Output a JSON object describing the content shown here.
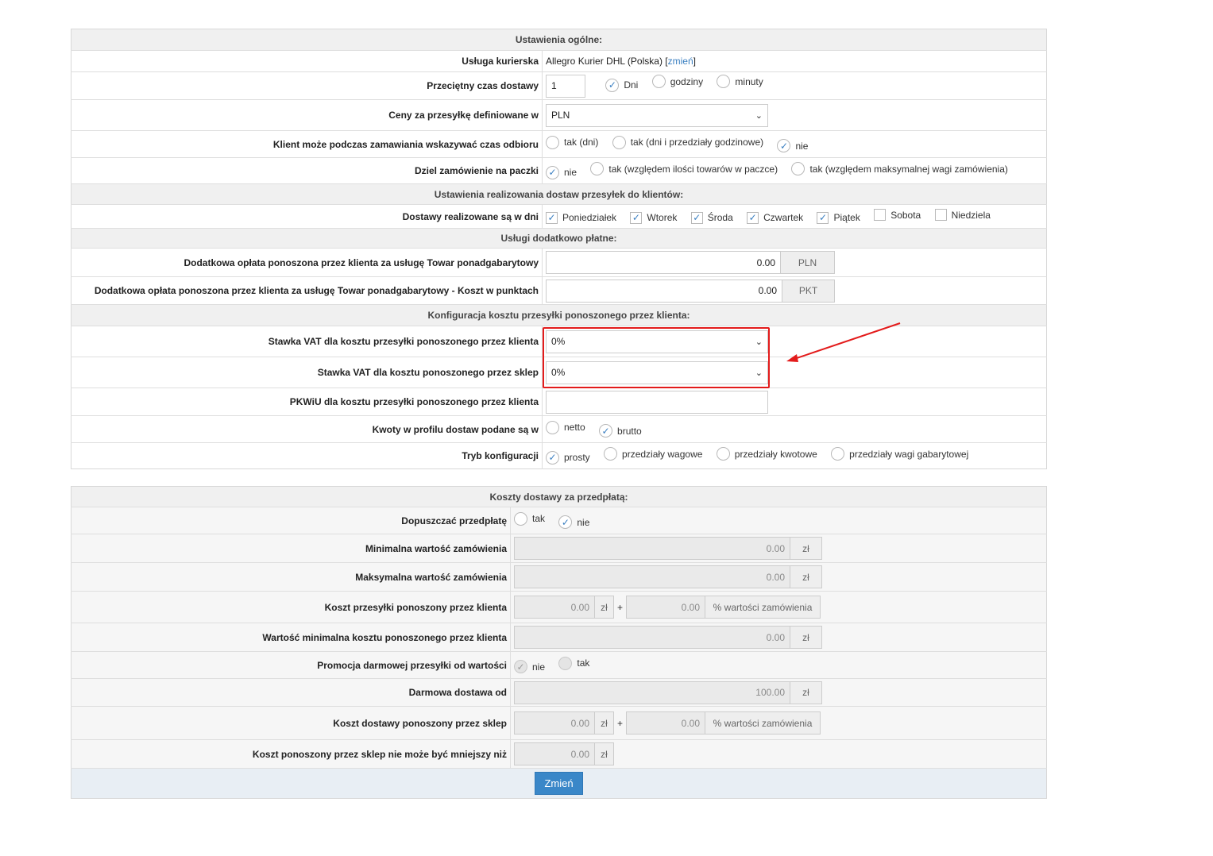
{
  "general": {
    "header": "Ustawienia ogólne:",
    "courier_label": "Usługa kurierska",
    "courier_value": "Allegro Kurier DHL (Polska)",
    "courier_change": "zmień",
    "avg_time_label": "Przeciętny czas dostawy",
    "avg_time_value": "1",
    "avg_time_units": [
      "Dni",
      "godziny",
      "minuty"
    ],
    "currency_label": "Ceny za przesyłkę definiowane w",
    "currency_value": "PLN",
    "pickup_label": "Klient może podczas zamawiania wskazywać czas odbioru",
    "pickup_options": [
      "tak (dni)",
      "tak (dni i przedziały godzinowe)",
      "nie"
    ],
    "split_label": "Dziel zamówienie na paczki",
    "split_options": [
      "nie",
      "tak (względem ilości towarów w paczce)",
      "tak (względem maksymalnej wagi zamówienia)"
    ]
  },
  "delivery": {
    "header": "Ustawienia realizowania dostaw przesyłek do klientów:",
    "days_label": "Dostawy realizowane są w dni",
    "days": [
      "Poniedziałek",
      "Wtorek",
      "Środa",
      "Czwartek",
      "Piątek",
      "Sobota",
      "Niedziela"
    ]
  },
  "extras": {
    "header": "Usługi dodatkowo płatne:",
    "oversize_label": "Dodatkowa opłata ponoszona przez klienta za usługę Towar ponadgabarytowy",
    "oversize_value": "0.00",
    "oversize_unit": "PLN",
    "oversize_points_label": "Dodatkowa opłata ponoszona przez klienta za usługę Towar ponadgabarytowy - Koszt w punktach",
    "oversize_points_value": "0.00",
    "oversize_points_unit": "PKT"
  },
  "cost_config": {
    "header": "Konfiguracja kosztu przesyłki ponoszonego przez klienta:",
    "vat_client_label": "Stawka VAT dla kosztu przesyłki ponoszonego przez klienta",
    "vat_client_value": "0%",
    "vat_shop_label": "Stawka VAT dla kosztu ponoszonego przez sklep",
    "vat_shop_value": "0%",
    "pkwiu_label": "PKWiU dla kosztu przesyłki ponoszonego przez klienta",
    "amounts_label": "Kwoty w profilu dostaw podane są w",
    "amounts_options": [
      "netto",
      "brutto"
    ],
    "mode_label": "Tryb konfiguracji",
    "mode_options": [
      "prosty",
      "przedziały wagowe",
      "przedziały kwotowe",
      "przedziały wagi gabarytowej"
    ]
  },
  "prepaid": {
    "header": "Koszty dostawy za przedpłatą:",
    "allow_label": "Dopuszczać przedpłatę",
    "allow_options": [
      "tak",
      "nie"
    ],
    "min_label": "Minimalna wartość zamówienia",
    "min_value": "0.00",
    "max_label": "Maksymalna wartość zamówienia",
    "max_value": "0.00",
    "client_cost_label": "Koszt przesyłki ponoszony przez klienta",
    "client_cost_value": "0.00",
    "client_cost_pct": "0.00",
    "min_client_cost_label": "Wartość minimalna kosztu ponoszonego przez klienta",
    "min_client_cost_value": "0.00",
    "promo_label": "Promocja darmowej przesyłki od wartości",
    "promo_options": [
      "nie",
      "tak"
    ],
    "free_from_label": "Darmowa dostawa od",
    "free_from_value": "100.00",
    "shop_cost_label": "Koszt dostawy ponoszony przez sklep",
    "shop_cost_value": "0.00",
    "shop_cost_pct": "0.00",
    "shop_min_label": "Koszt ponoszony przez sklep nie może być mniejszy niż",
    "shop_min_value": "0.00",
    "currency": "zł",
    "plus": "+",
    "pct_label": "% wartości zamówienia",
    "submit": "Zmień"
  },
  "colors": {
    "accent": "#3a87c8",
    "highlight": "#e31b1b"
  }
}
